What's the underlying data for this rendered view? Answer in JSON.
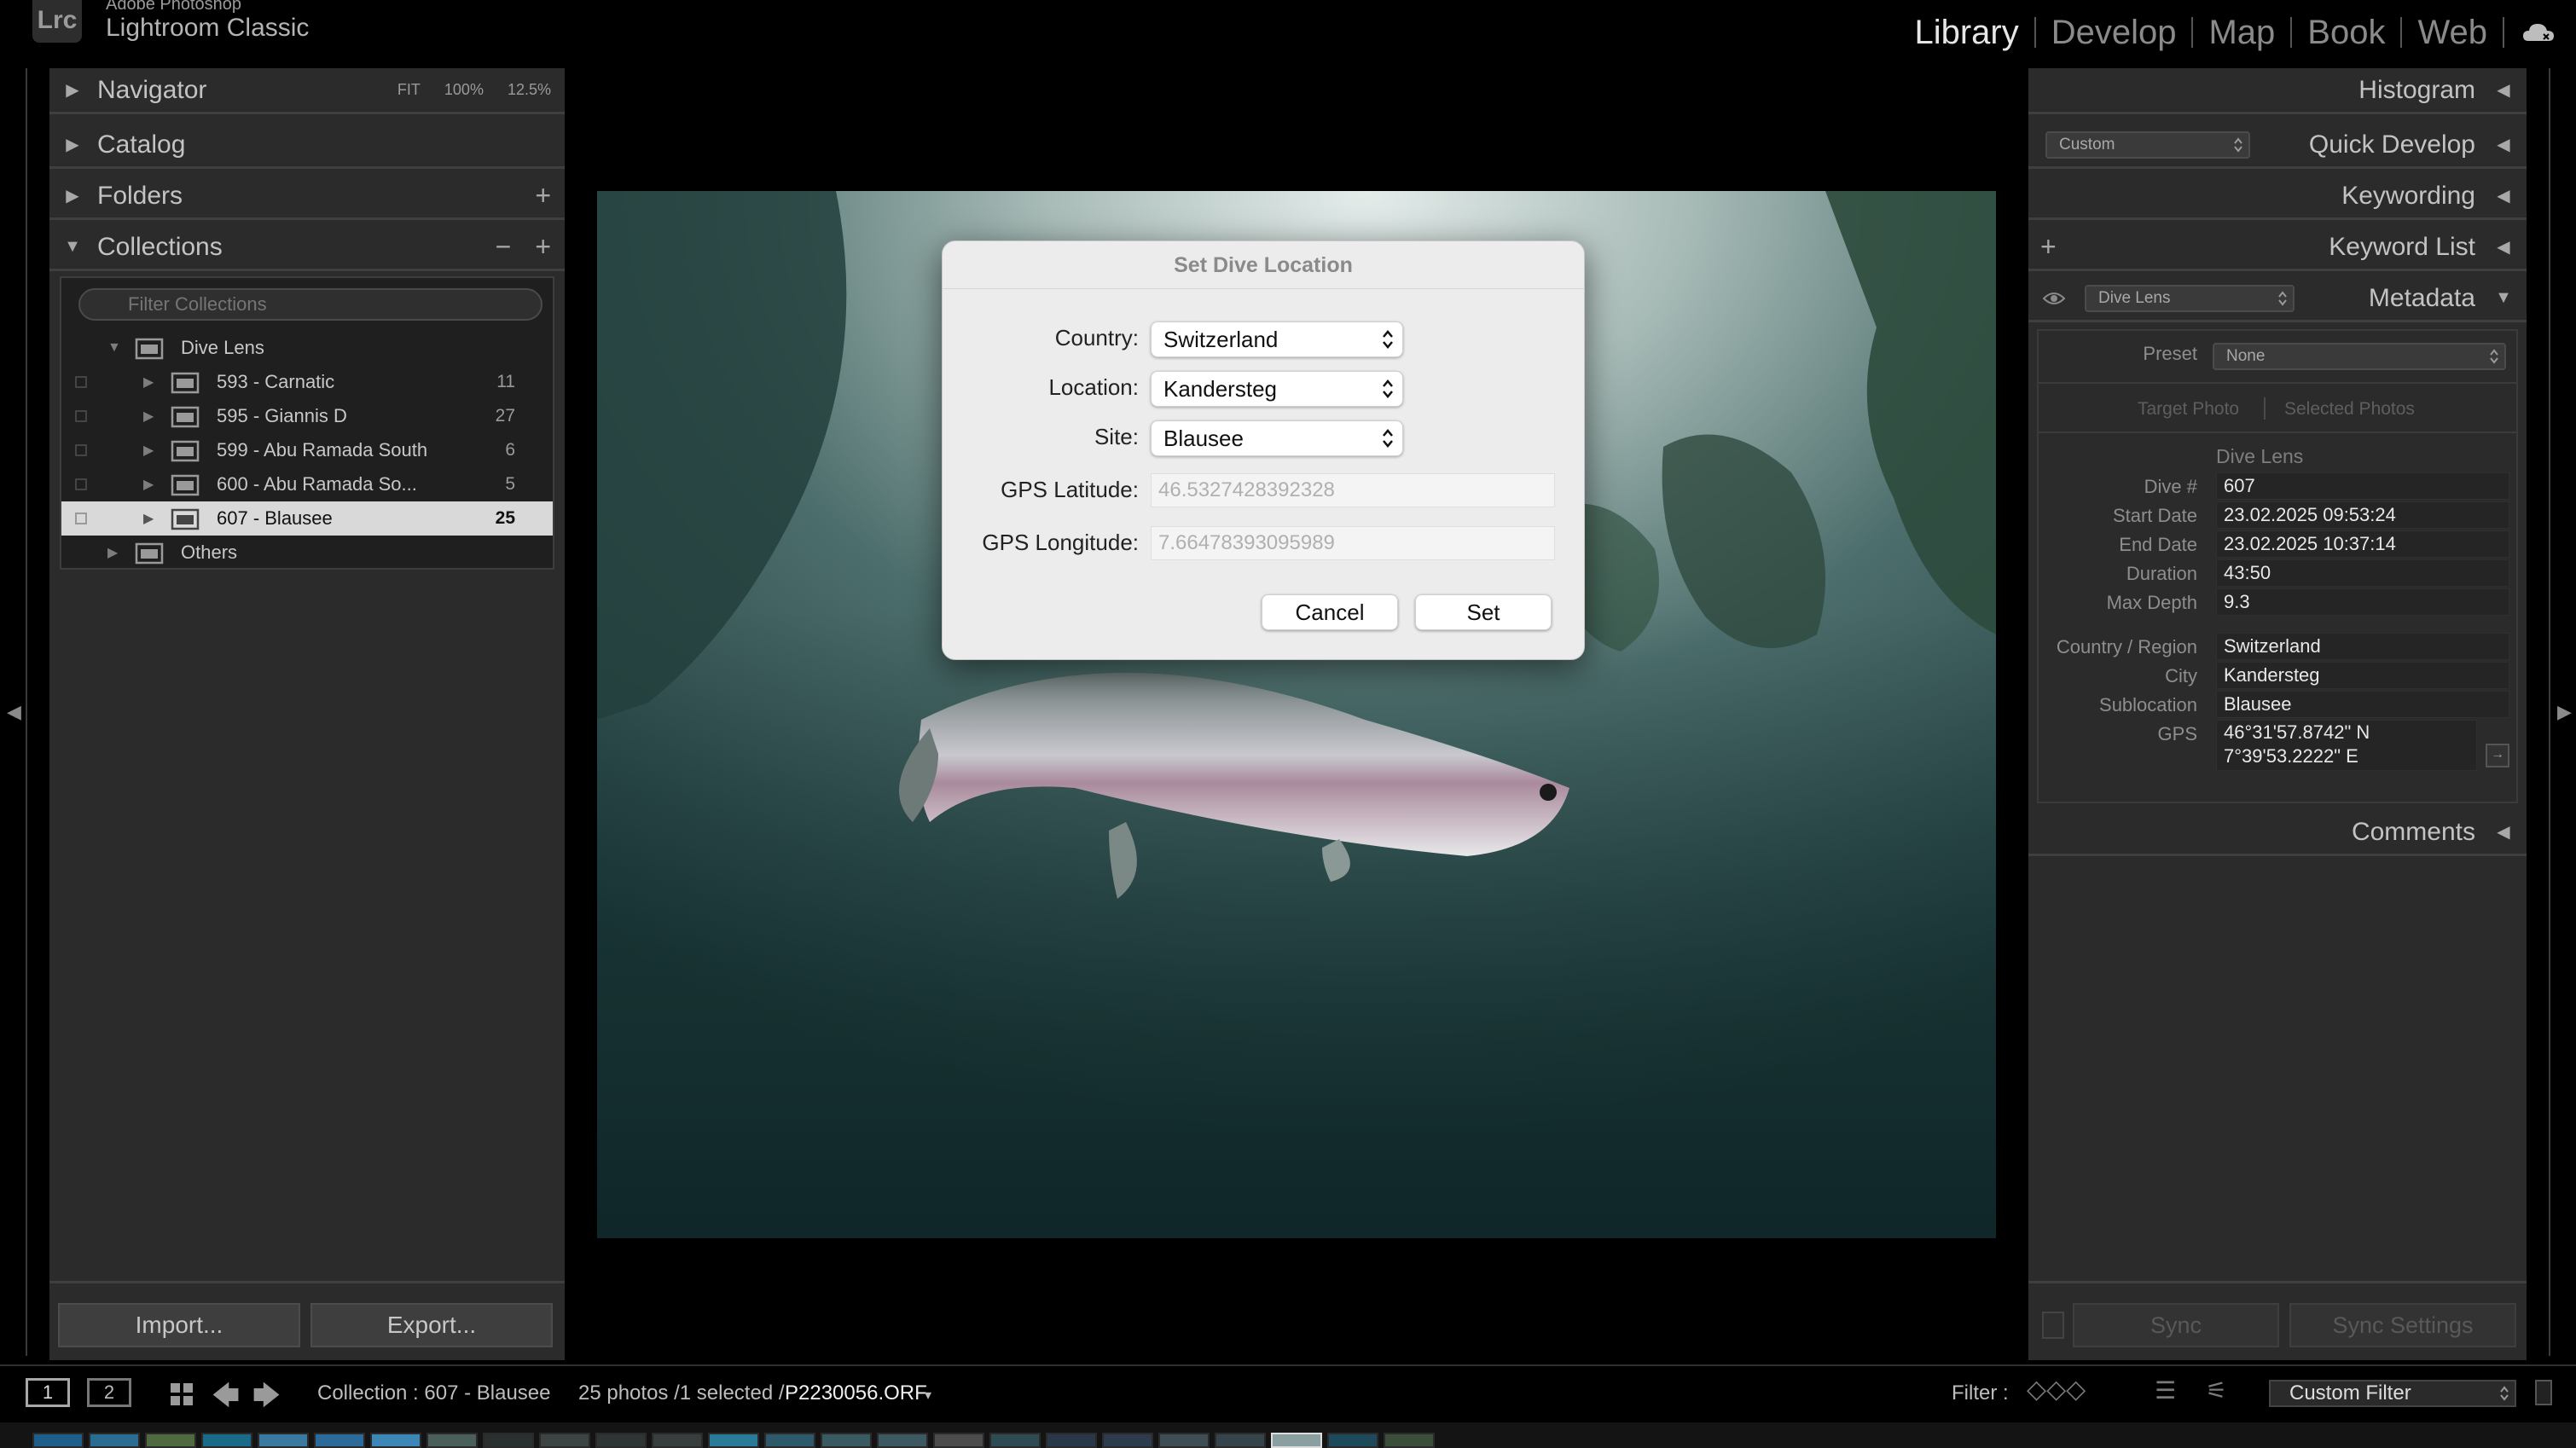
{
  "app": {
    "logo_text": "Lrc",
    "brand_line1": "Adobe Photoshop",
    "brand_line2": "Lightroom Classic"
  },
  "modules": [
    "Library",
    "Develop",
    "Map",
    "Book",
    "Web"
  ],
  "active_module": "Library",
  "left_panel": {
    "navigator": {
      "title": "Navigator",
      "zoom_fit": "FIT",
      "zoom_100": "100%",
      "zoom_custom": "12.5%"
    },
    "catalog": {
      "title": "Catalog"
    },
    "folders": {
      "title": "Folders"
    },
    "collections": {
      "title": "Collections",
      "filter_placeholder": "Filter Collections",
      "parent": "Dive Lens",
      "items": [
        {
          "label": "593 - Carnatic",
          "count": "11"
        },
        {
          "label": "595 - Giannis D",
          "count": "27"
        },
        {
          "label": "599 - Abu Ramada South",
          "count": "6"
        },
        {
          "label": "600 - Abu Ramada So...",
          "count": "5"
        },
        {
          "label": "607 - Blausee",
          "count": "25"
        }
      ],
      "selected_index": 4,
      "others": "Others"
    },
    "import_label": "Import...",
    "export_label": "Export..."
  },
  "dialog": {
    "title": "Set Dive Location",
    "country_label": "Country:",
    "country_value": "Switzerland",
    "location_label": "Location:",
    "location_value": "Kandersteg",
    "site_label": "Site:",
    "site_value": "Blausee",
    "lat_label": "GPS Latitude:",
    "lat_placeholder": "46.5327428392328",
    "lon_label": "GPS Longitude:",
    "lon_placeholder": "7.66478393095989",
    "cancel_label": "Cancel",
    "set_label": "Set"
  },
  "right_panel": {
    "histogram": "Histogram",
    "quick_develop": "Quick Develop",
    "quick_develop_preset": "Custom",
    "keywording": "Keywording",
    "keyword_list": "Keyword List",
    "metadata": "Metadata",
    "metadata_set": "Dive Lens",
    "preset_label": "Preset",
    "preset_value": "None",
    "target_photo": "Target Photo",
    "selected_photos": "Selected Photos",
    "section_title": "Dive Lens",
    "fields": [
      {
        "label": "Dive #",
        "value": "607"
      },
      {
        "label": "Start Date",
        "value": "23.02.2025 09:53:24"
      },
      {
        "label": "End Date",
        "value": "23.02.2025 10:37:14"
      },
      {
        "label": "Duration",
        "value": "43:50"
      },
      {
        "label": "Max Depth",
        "value": "9.3"
      }
    ],
    "location_fields": [
      {
        "label": "Country / Region",
        "value": "Switzerland"
      },
      {
        "label": "City",
        "value": "Kandersteg"
      },
      {
        "label": "Sublocation",
        "value": "Blausee"
      }
    ],
    "gps_label": "GPS",
    "gps_line1": "46°31'57.8742\" N",
    "gps_line2": "7°39'53.2222\" E",
    "comments": "Comments",
    "sync_label": "Sync",
    "sync_settings_label": "Sync Settings"
  },
  "bottom_bar": {
    "view1": "1",
    "view2": "2",
    "collection_text": "Collection : 607 - Blausee",
    "photos_text": "25 photos /1 selected /",
    "filename": "P2230056.ORF",
    "filter_label": "Filter :",
    "filter_value": "Custom Filter"
  },
  "colors": {
    "background": "#000000",
    "panel": "#2b2b2b",
    "selected_row": "#d9d9d9",
    "dialog": "#ececec"
  },
  "icons": [
    "cloud-icon",
    "search-icon",
    "grid-icon",
    "prev-arrow-icon",
    "next-arrow-icon",
    "eye-icon",
    "collection-set-icon"
  ]
}
